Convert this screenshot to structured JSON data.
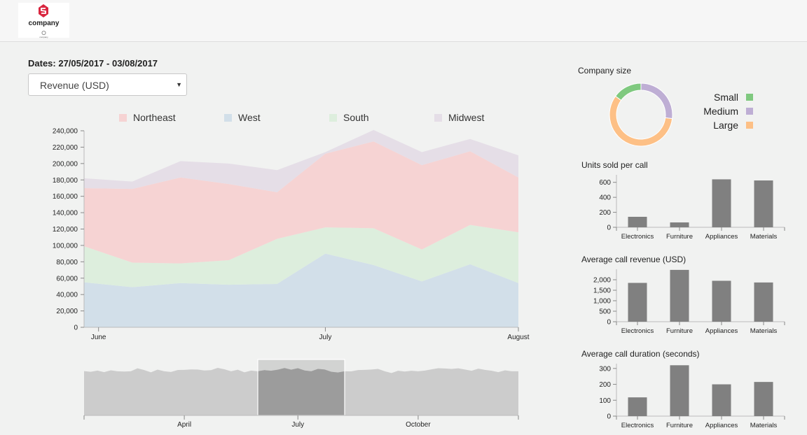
{
  "header": {
    "logo_name": "company",
    "logo_subtext": "company"
  },
  "controls": {
    "dates_label": "Dates: 27/05/2017 - 03/08/2017",
    "metric_select_value": "Revenue (USD)"
  },
  "colors": {
    "northeast": "#f6d3d3",
    "west": "#d2dfe9",
    "south": "#ddeedd",
    "midwest": "#e5dee7",
    "small": "#7fc97f",
    "medium": "#beaed4",
    "large": "#fdc086",
    "bar": "#808080",
    "brush_area": "#cccccc",
    "brush_selection": "#a9a9a9"
  },
  "chart_data": [
    {
      "type": "area",
      "stacked": true,
      "legend_position": "top",
      "series": [
        {
          "name": "West",
          "values": [
            55000,
            49000,
            54000,
            52000,
            53000,
            90000,
            76000,
            56000,
            77000,
            54000
          ]
        },
        {
          "name": "South",
          "values": [
            44000,
            30000,
            24000,
            30000,
            55000,
            32000,
            45000,
            39000,
            48000,
            62000
          ]
        },
        {
          "name": "Northeast",
          "values": [
            71000,
            90000,
            105000,
            93000,
            57000,
            90000,
            106000,
            103000,
            90000,
            67000
          ]
        },
        {
          "name": "Midwest",
          "values": [
            12000,
            9000,
            20000,
            25000,
            27000,
            2000,
            14000,
            16000,
            15000,
            27000
          ]
        }
      ],
      "x_index": [
        0,
        1,
        2,
        3,
        4,
        5,
        6,
        7,
        8,
        9
      ],
      "x_ticks": [
        {
          "label": "June",
          "at": 0.3
        },
        {
          "label": "July",
          "at": 5.0
        },
        {
          "label": "August",
          "at": 9.0
        }
      ],
      "ylim": [
        0,
        240000
      ],
      "y_ticks": [
        0,
        20000,
        40000,
        60000,
        80000,
        100000,
        120000,
        140000,
        160000,
        180000,
        200000,
        220000,
        240000
      ],
      "y_tick_labels": [
        "0",
        "20,000",
        "40,000",
        "60,000",
        "80,000",
        "100,000",
        "120,000",
        "140,000",
        "160,000",
        "180,000",
        "200,000",
        "220,000",
        "240,000"
      ]
    },
    {
      "type": "area",
      "role": "overview-brush",
      "values": [
        2790,
        2742,
        2819,
        2722,
        2838,
        2780,
        2760,
        2780,
        2962,
        2857,
        2712,
        2880,
        2780,
        2732,
        2857,
        2867,
        2895,
        2886,
        2828,
        2847,
        2991,
        2905,
        2780,
        2876,
        2712,
        2819,
        2780,
        2847,
        2809,
        2876,
        2982,
        2876,
        2972,
        2828,
        2780,
        2924,
        2886,
        2742,
        2703,
        2780,
        2770,
        2857,
        2867,
        2886,
        2924,
        2780,
        2665,
        2809,
        2761,
        2809,
        2780,
        2819,
        2896,
        2972,
        2953,
        2924,
        2962,
        2886,
        2809,
        2943,
        2867,
        2809,
        2722,
        2838,
        2780,
        2780
      ],
      "ylim": [
        0,
        3300
      ],
      "x_ticks": [
        {
          "label": "April",
          "at": 15
        },
        {
          "label": "July",
          "at": 32
        },
        {
          "label": "October",
          "at": 50
        }
      ],
      "selection_index_range": [
        26,
        39
      ]
    },
    {
      "type": "pie",
      "variant": "donut",
      "title": "Company size",
      "legend_position": "right",
      "slices": [
        {
          "label": "Small",
          "value": 15
        },
        {
          "label": "Medium",
          "value": 27
        },
        {
          "label": "Large",
          "value": 58
        }
      ]
    },
    {
      "type": "bar",
      "title": "Units sold per call",
      "categories": [
        "Electronics",
        "Furniture",
        "Appliances",
        "Materials"
      ],
      "values": [
        140,
        65,
        640,
        625
      ],
      "ylim": [
        0,
        700
      ],
      "y_ticks": [
        0,
        200,
        400,
        600
      ],
      "y_tick_labels": [
        "0",
        "200",
        "400",
        "600"
      ]
    },
    {
      "type": "bar",
      "title": "Average call revenue (USD)",
      "categories": [
        "Electronics",
        "Furniture",
        "Appliances",
        "Materials"
      ],
      "values": [
        1850,
        2470,
        1950,
        1870
      ],
      "ylim": [
        0,
        2500
      ],
      "y_ticks": [
        0,
        500,
        1000,
        1500,
        2000
      ],
      "y_tick_labels": [
        "0",
        "500",
        "1,000",
        "1,500",
        "2,000"
      ]
    },
    {
      "type": "bar",
      "title": "Average call duration (seconds)",
      "categories": [
        "Electronics",
        "Furniture",
        "Appliances",
        "Materials"
      ],
      "values": [
        118,
        320,
        200,
        215
      ],
      "ylim": [
        0,
        330
      ],
      "y_ticks": [
        0,
        100,
        200,
        300
      ],
      "y_tick_labels": [
        "0",
        "100",
        "200",
        "300"
      ]
    }
  ]
}
